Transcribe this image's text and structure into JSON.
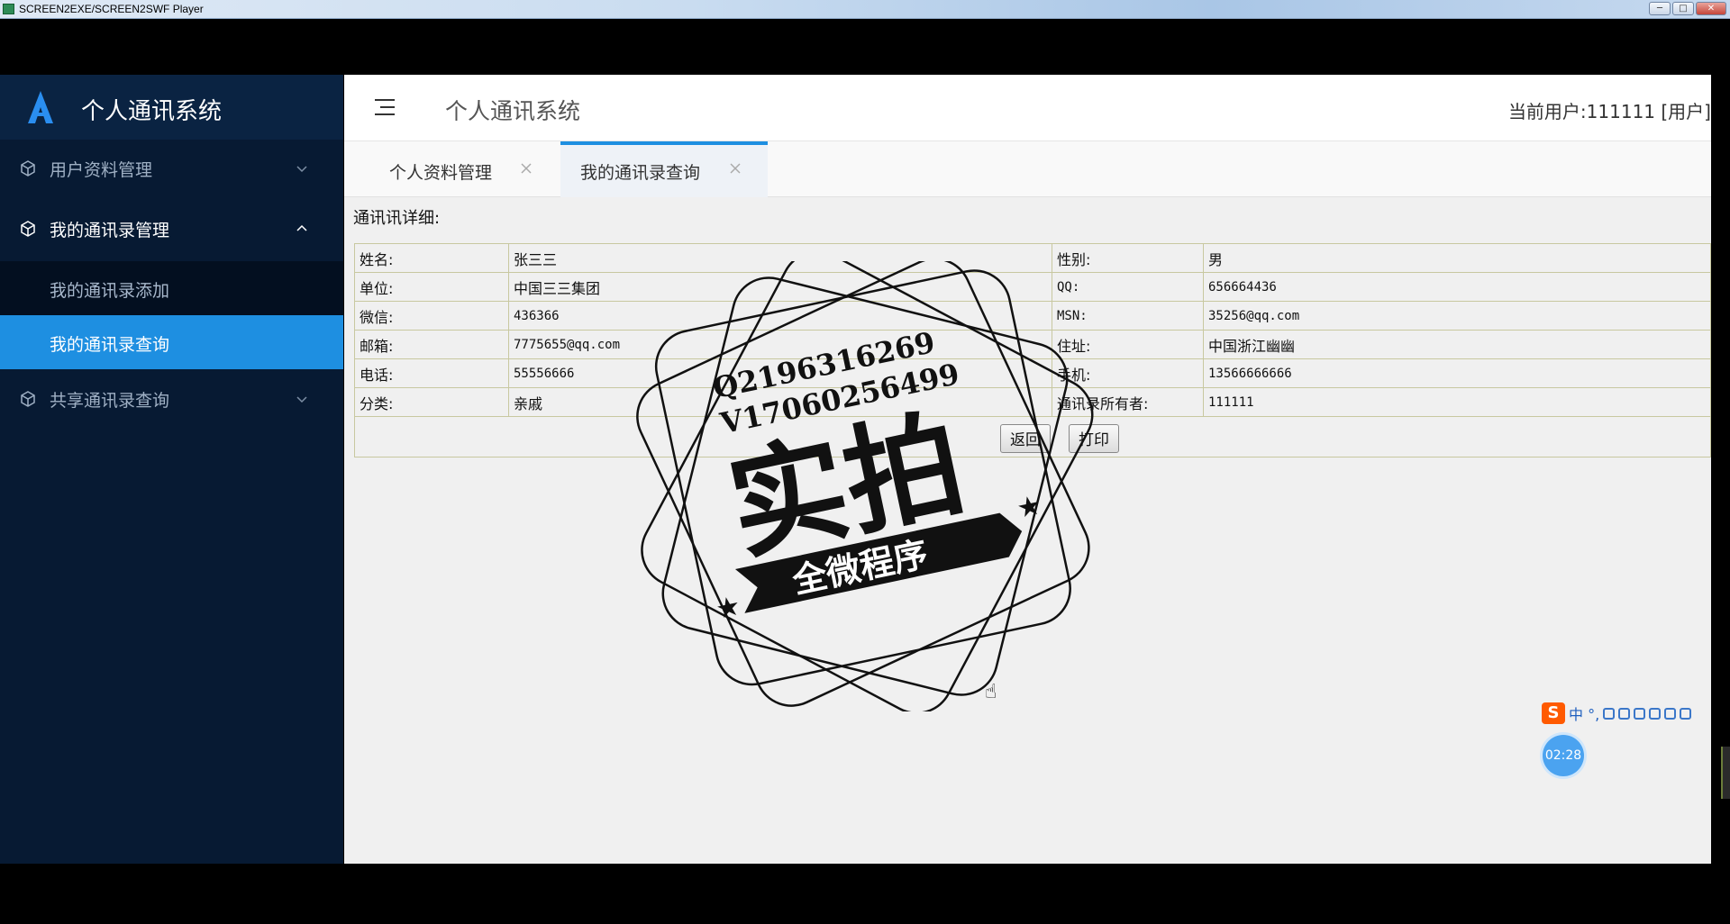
{
  "player": {
    "title": "SCREEN2EXE/SCREEN2SWF Player",
    "buttons": [
      "─",
      "□",
      "✕"
    ]
  },
  "sidebar": {
    "brand": "个人通讯系统",
    "items": [
      {
        "label": "用户资料管理",
        "icon": "cube-icon",
        "chevron": "chevron-down-icon"
      },
      {
        "label": "我的通讯录管理",
        "icon": "cube-icon",
        "chevron": "chevron-up-icon"
      },
      {
        "label": "共享通讯录查询",
        "icon": "cube-icon",
        "chevron": "chevron-down-icon"
      }
    ],
    "submenu": [
      {
        "label": "我的通讯录添加"
      },
      {
        "label": "我的通讯录查询"
      }
    ]
  },
  "topbar": {
    "title": "个人通讯系统",
    "user": "当前用户:111111 [用户]"
  },
  "tabs": [
    {
      "label": "个人资料管理"
    },
    {
      "label": "我的通讯录查询"
    }
  ],
  "detail": {
    "heading": "通讯讯详细:",
    "rows": [
      {
        "l1": "姓名:",
        "v1": "张三三",
        "l2": "性别:",
        "v2": "男"
      },
      {
        "l1": "单位:",
        "v1": "中国三三集团",
        "l2": "QQ:",
        "v2": "656664436"
      },
      {
        "l1": "微信:",
        "v1": "436366",
        "l2": "MSN:",
        "v2": "35256@qq.com"
      },
      {
        "l1": "邮箱:",
        "v1": "7775655@qq.com",
        "l2": "住址:",
        "v2": "中国浙江幽幽"
      },
      {
        "l1": "电话:",
        "v1": "55556666",
        "l2": "手机:",
        "v2": "13566666666"
      },
      {
        "l1": "分类:",
        "v1": "亲戚",
        "l2": "通讯录所有者:",
        "v2": "111111"
      }
    ],
    "back_label": "返回",
    "print_label": "打印"
  },
  "watermark": {
    "line1": "Q2196316269",
    "line2": "V17060256499",
    "main": "实拍",
    "banner": "全微程序"
  },
  "ime": {
    "logo": "S",
    "text": "中 °, "
  },
  "timer": "02:28"
}
